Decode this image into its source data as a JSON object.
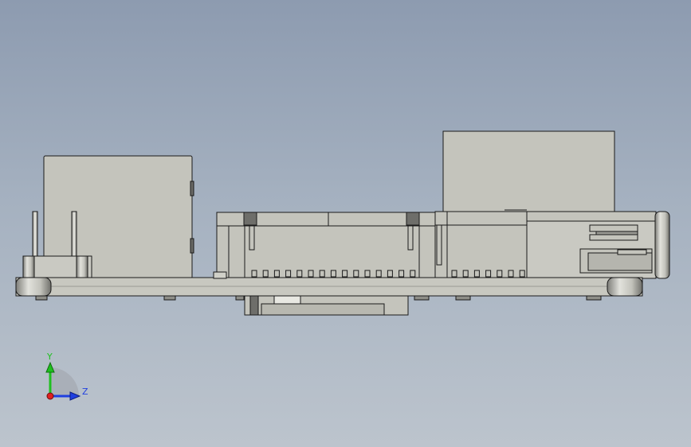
{
  "viewport": {
    "background_top": "#8d9bb0",
    "background_bottom": "#bcc4cd"
  },
  "model": {
    "body_color": "#c4c4bc",
    "edge_color": "#1a1a1a",
    "board_color": "#c8c8c0"
  },
  "triad": {
    "y_label": "Y",
    "z_label": "Z",
    "y_color": "#1fc01f",
    "z_color": "#1f3fe0",
    "x_color": "#e01f1f"
  }
}
